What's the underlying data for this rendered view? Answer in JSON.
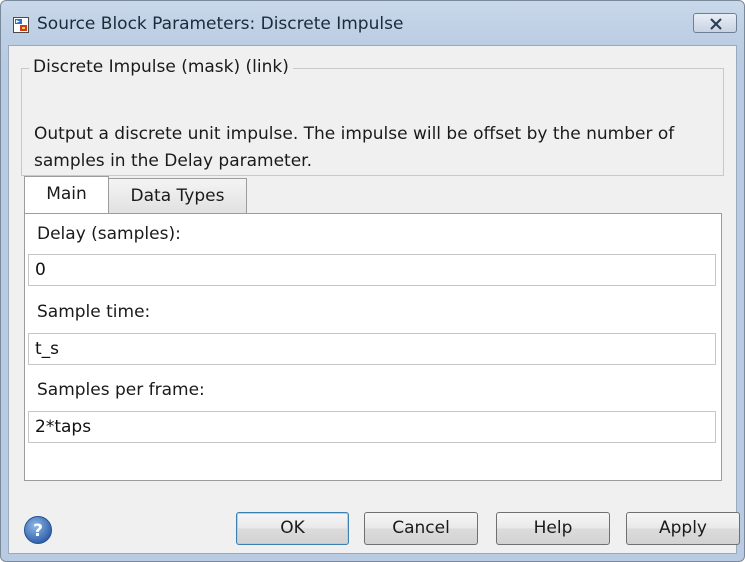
{
  "window": {
    "title": "Source Block Parameters: Discrete Impulse",
    "app_icon": "simulink-block-icon",
    "close_icon": "close-x-icon"
  },
  "group": {
    "legend": "Discrete Impulse  (mask) (link)",
    "description": "Output a discrete unit impulse.  The impulse will be offset by the number of samples in the Delay parameter."
  },
  "tabs": [
    {
      "label": "Main",
      "selected": true
    },
    {
      "label": "Data Types",
      "selected": false
    }
  ],
  "fields": [
    {
      "label": "Delay (samples):",
      "value": "0"
    },
    {
      "label": "Sample time:",
      "value": "t_s"
    },
    {
      "label": "Samples per frame:",
      "value": "2*taps"
    }
  ],
  "buttons": {
    "help_icon": "question-circle-icon",
    "ok": "OK",
    "cancel": "Cancel",
    "help": "Help",
    "apply": "Apply"
  },
  "colors": {
    "title_bar": "#bfd0e5",
    "dialog_bg": "#f0f0f0",
    "default_button_border": "#3c7fb1",
    "help_icon": "#3f6fb3"
  }
}
